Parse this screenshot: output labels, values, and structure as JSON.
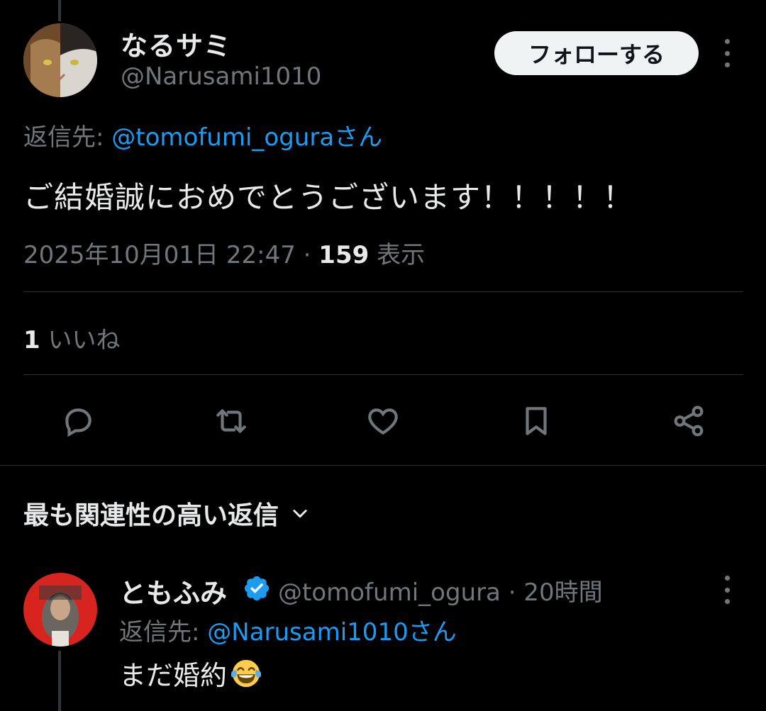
{
  "tweet": {
    "author_name": "なるサミ",
    "author_handle": "@Narusami1010",
    "follow_label": "フォローする",
    "reply_prefix": "返信先: ",
    "reply_to_handle": "@tomofumi_oguraさん",
    "text": "ご結婚誠におめでとうございます！！！！！",
    "timestamp": "2025年10月01日 22:47",
    "separator": " · ",
    "views_count": "159",
    "views_label": " 表示",
    "likes_count": "1",
    "likes_label": " いいね"
  },
  "actions": [
    {
      "icon": "reply-icon"
    },
    {
      "icon": "retweet-icon"
    },
    {
      "icon": "like-icon"
    },
    {
      "icon": "bookmark-icon"
    },
    {
      "icon": "share-icon"
    }
  ],
  "replies_sort": {
    "label": "最も関連性の高い返信",
    "icon": "chevron-down-icon"
  },
  "reply": {
    "author_name": "ともふみ",
    "verified": true,
    "author_handle": "@tomofumi_ogura",
    "time": "· 20時間",
    "reply_prefix": "返信先: ",
    "reply_to_handle": "@Narusami1010さん",
    "text": "まだ婚約",
    "emoji": "face-with-tears-of-joy"
  },
  "colors": {
    "background": "#000000",
    "primary_text": "#e7e9ea",
    "secondary_text": "#71767b",
    "link": "#1d9bf0",
    "divider": "#2f3336",
    "follow_button_bg": "#eff3f4"
  }
}
